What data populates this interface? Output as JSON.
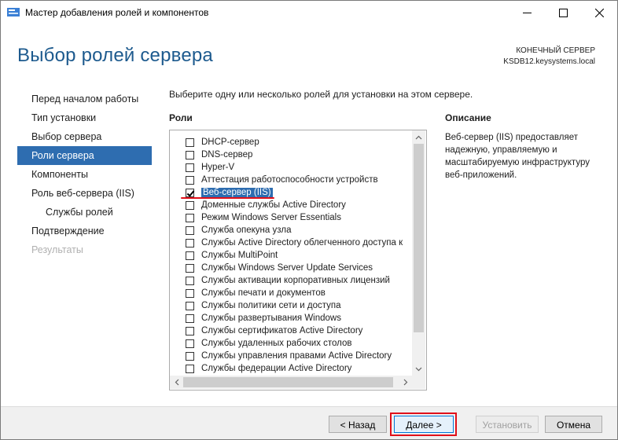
{
  "window": {
    "title": "Мастер добавления ролей и компонентов",
    "minimize_glyph": "—",
    "maximize_glyph": "☐",
    "close_glyph": "✕"
  },
  "header": {
    "page_title": "Выбор ролей сервера",
    "destination_label": "КОНЕЧНЫЙ СЕРВЕР",
    "destination_server": "KSDB12.keysystems.local"
  },
  "nav": {
    "items": [
      {
        "label": "Перед началом работы",
        "state": "normal"
      },
      {
        "label": "Тип установки",
        "state": "normal"
      },
      {
        "label": "Выбор сервера",
        "state": "normal"
      },
      {
        "label": "Роли сервера",
        "state": "active"
      },
      {
        "label": "Компоненты",
        "state": "normal"
      },
      {
        "label": "Роль веб-сервера (IIS)",
        "state": "normal"
      },
      {
        "label": "Службы ролей",
        "state": "sub"
      },
      {
        "label": "Подтверждение",
        "state": "normal"
      },
      {
        "label": "Результаты",
        "state": "disabled"
      }
    ]
  },
  "main": {
    "instruction": "Выберите одну или несколько ролей для установки на этом сервере.",
    "roles_header": "Роли",
    "description_header": "Описание",
    "description_text": "Веб-сервер (IIS) предоставляет надежную, управляемую и масштабируемую инфраструктуру веб-приложений.",
    "roles": [
      {
        "label": "DHCP-сервер",
        "checked": false,
        "selected": false
      },
      {
        "label": "DNS-сервер",
        "checked": false,
        "selected": false
      },
      {
        "label": "Hyper-V",
        "checked": false,
        "selected": false
      },
      {
        "label": "Аттестация работоспособности устройств",
        "checked": false,
        "selected": false
      },
      {
        "label": "Веб-сервер (IIS)",
        "checked": true,
        "selected": true
      },
      {
        "label": "Доменные службы Active Directory",
        "checked": false,
        "selected": false
      },
      {
        "label": "Режим Windows Server Essentials",
        "checked": false,
        "selected": false
      },
      {
        "label": "Служба опекуна узла",
        "checked": false,
        "selected": false
      },
      {
        "label": "Службы Active Directory облегченного доступа к",
        "checked": false,
        "selected": false
      },
      {
        "label": "Службы MultiPoint",
        "checked": false,
        "selected": false
      },
      {
        "label": "Службы Windows Server Update Services",
        "checked": false,
        "selected": false
      },
      {
        "label": "Службы активации корпоративных лицензий",
        "checked": false,
        "selected": false
      },
      {
        "label": "Службы печати и документов",
        "checked": false,
        "selected": false
      },
      {
        "label": "Службы политики сети и доступа",
        "checked": false,
        "selected": false
      },
      {
        "label": "Службы развертывания Windows",
        "checked": false,
        "selected": false
      },
      {
        "label": "Службы сертификатов Active Directory",
        "checked": false,
        "selected": false
      },
      {
        "label": "Службы удаленных рабочих столов",
        "checked": false,
        "selected": false
      },
      {
        "label": "Службы управления правами Active Directory",
        "checked": false,
        "selected": false
      },
      {
        "label": "Службы федерации Active Directory",
        "checked": false,
        "selected": false
      }
    ]
  },
  "footer": {
    "back_label": "< Назад",
    "next_label": "Далее >",
    "install_label": "Установить",
    "cancel_label": "Отмена"
  },
  "colors": {
    "title_blue": "#1d5a8e",
    "selection_blue": "#2e6db0",
    "annotation_red": "#e0101a"
  }
}
